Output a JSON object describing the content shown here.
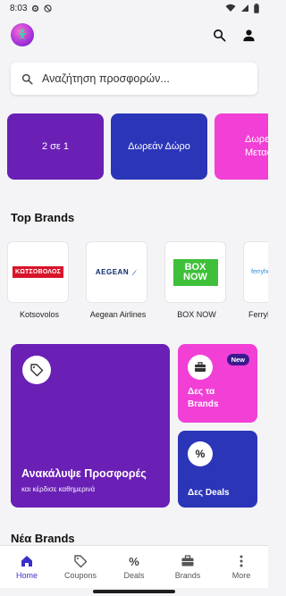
{
  "status_bar": {
    "time": "8:03",
    "icons": [
      "gear-icon",
      "no-disturb-icon",
      "wifi-icon",
      "signal-icon",
      "battery-icon"
    ]
  },
  "header": {
    "logo_icon": "app-logo",
    "search_icon": "search-icon",
    "profile_icon": "person-icon"
  },
  "search": {
    "placeholder": "Αναζήτηση προσφορών..."
  },
  "promos": [
    {
      "label": "2 σε 1",
      "color": "#6a1fb5"
    },
    {
      "label": "Δωρεάν Δώρο",
      "color": "#2b35b8"
    },
    {
      "label": "Δωρεάν Μεταφορικά",
      "color": "#f23fd6"
    }
  ],
  "top_brands": {
    "title": "Top Brands",
    "items": [
      {
        "name": "Kotsovolos",
        "logo_text": "ΚΩΤΣΟΒΟΛΟΣ"
      },
      {
        "name": "Aegean Airlines",
        "logo_text": "AEGEAN"
      },
      {
        "name": "BOX NOW",
        "logo_text": "BOX NOW"
      },
      {
        "name": "Ferryhopper",
        "logo_text": "ferryhopper"
      }
    ]
  },
  "discover": {
    "title": "Ανακάλυψε Προσφορές",
    "subtitle": "και κέρδισε καθημερινά",
    "icon": "tag-icon"
  },
  "brands_card": {
    "badge": "New",
    "label": "Δες τα Brands",
    "icon": "briefcase-icon"
  },
  "deals_card": {
    "label": "Δες Deals",
    "icon": "percent-icon"
  },
  "new_brands": {
    "title": "Νέα Brands"
  },
  "nav": [
    {
      "label": "Home",
      "icon": "home-icon",
      "active": true
    },
    {
      "label": "Coupons",
      "icon": "tag-icon",
      "active": false
    },
    {
      "label": "Deals",
      "icon": "percent-icon",
      "active": false
    },
    {
      "label": "Brands",
      "icon": "briefcase-icon",
      "active": false
    },
    {
      "label": "More",
      "icon": "more-vertical-icon",
      "active": false
    }
  ]
}
